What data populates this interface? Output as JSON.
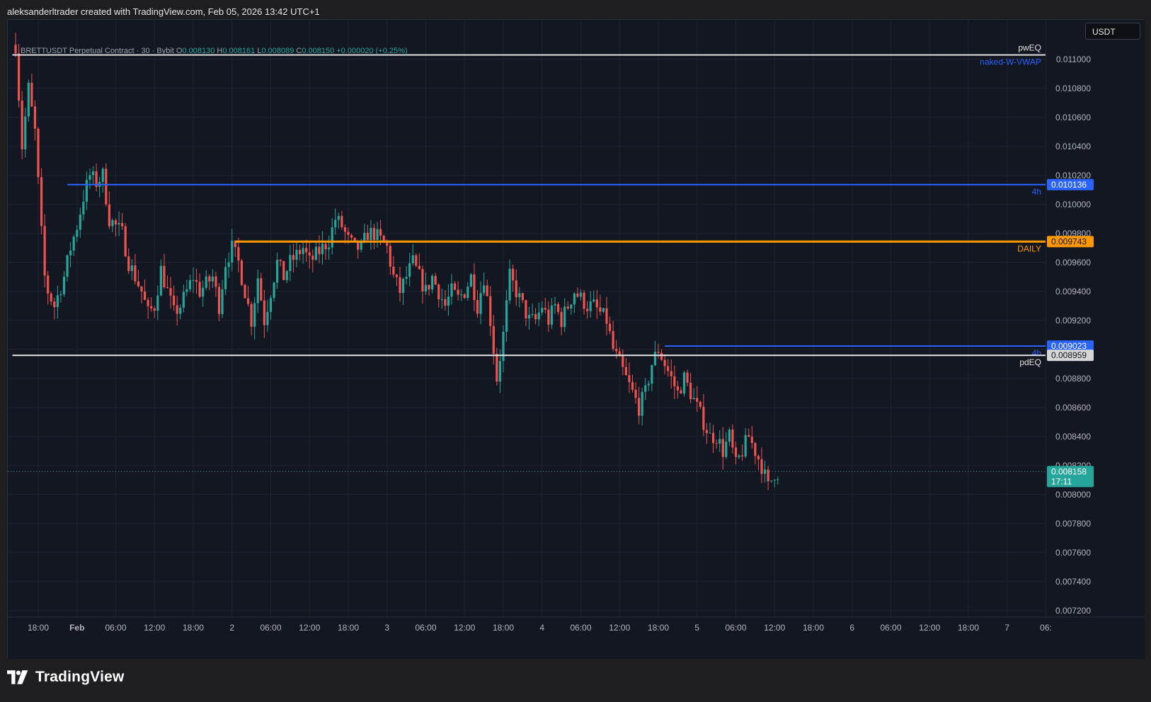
{
  "header": {
    "attribution": "aleksanderltrader created with TradingView.com, Feb 05, 2026 13:42 UTC+1"
  },
  "legend": {
    "symbol": "BRETTUSDT Perpetual Contract · 30 · Bybit",
    "open_label": "O",
    "open": "0.008130",
    "high_label": "H",
    "high": "0.008161",
    "low_label": "L",
    "low": "0.008089",
    "close_label": "C",
    "close": "0.008150",
    "change": "+0.000020 (+0.25%)"
  },
  "currency": "USDT",
  "brand": {
    "name": "TradingView"
  },
  "colors": {
    "up": "#26a69a",
    "down": "#ef5350",
    "blue_level": "#2962ff",
    "orange_level": "#ff9800",
    "white_level": "#e0e0e0",
    "background": "#131722",
    "grid": "#1f2330"
  },
  "chart_data": {
    "type": "candlestick",
    "symbol": "BRETTUSDT Perpetual Contract",
    "interval": "30",
    "exchange": "Bybit",
    "ylim": [
      0.0071,
      0.01115
    ],
    "y_ticks": [
      0.0072,
      0.0074,
      0.0076,
      0.0078,
      0.008,
      0.0082,
      0.0084,
      0.0086,
      0.0088,
      0.009,
      0.0092,
      0.0094,
      0.0096,
      0.0098,
      0.01,
      0.0102,
      0.0104,
      0.0106,
      0.0108,
      0.011
    ],
    "x_labels": [
      {
        "h": -6,
        "label": "18:00"
      },
      {
        "h": 0,
        "label": "Feb"
      },
      {
        "h": 6,
        "label": "06:00"
      },
      {
        "h": 12,
        "label": "12:00"
      },
      {
        "h": 18,
        "label": "18:00"
      },
      {
        "h": 24,
        "label": "2"
      },
      {
        "h": 30,
        "label": "06:00"
      },
      {
        "h": 36,
        "label": "12:00"
      },
      {
        "h": 42,
        "label": "18:00"
      },
      {
        "h": 48,
        "label": "3"
      },
      {
        "h": 54,
        "label": "06:00"
      },
      {
        "h": 60,
        "label": "12:00"
      },
      {
        "h": 66,
        "label": "18:00"
      },
      {
        "h": 72,
        "label": "4"
      },
      {
        "h": 78,
        "label": "06:00"
      },
      {
        "h": 84,
        "label": "12:00"
      },
      {
        "h": 90,
        "label": "18:00"
      },
      {
        "h": 96,
        "label": "5"
      },
      {
        "h": 102,
        "label": "06:00"
      },
      {
        "h": 108,
        "label": "12:00"
      },
      {
        "h": 114,
        "label": "18:00"
      },
      {
        "h": 120,
        "label": "6"
      },
      {
        "h": 126,
        "label": "06:00"
      },
      {
        "h": 132,
        "label": "12:00"
      },
      {
        "h": 138,
        "label": "18:00"
      },
      {
        "h": 144,
        "label": "7"
      },
      {
        "h": 150,
        "label": "06:"
      }
    ],
    "price_path": [
      [
        -9.5,
        0.0111
      ],
      [
        -8.5,
        0.0104
      ],
      [
        -7.5,
        0.0108
      ],
      [
        -6.5,
        0.0105
      ],
      [
        -5.5,
        0.0098
      ],
      [
        -5,
        0.0095
      ],
      [
        -4.5,
        0.0094
      ],
      [
        -3.5,
        0.0093
      ],
      [
        -2,
        0.0095
      ],
      [
        -1,
        0.0097
      ],
      [
        0,
        0.00985
      ],
      [
        0.5,
        0.00995
      ],
      [
        1,
        0.01005
      ],
      [
        2,
        0.0102
      ],
      [
        3,
        0.01015
      ],
      [
        4,
        0.0102
      ],
      [
        5,
        0.0099
      ],
      [
        6,
        0.00985
      ],
      [
        7,
        0.0098
      ],
      [
        8,
        0.0096
      ],
      [
        9,
        0.0095
      ],
      [
        10,
        0.0094
      ],
      [
        11,
        0.00925
      ],
      [
        12,
        0.0093
      ],
      [
        13,
        0.00955
      ],
      [
        14,
        0.0094
      ],
      [
        15,
        0.00925
      ],
      [
        16,
        0.0093
      ],
      [
        17,
        0.0094
      ],
      [
        18,
        0.0095
      ],
      [
        19,
        0.0094
      ],
      [
        20,
        0.00945
      ],
      [
        21,
        0.0095
      ],
      [
        22,
        0.0093
      ],
      [
        23,
        0.0096
      ],
      [
        24,
        0.0097
      ],
      [
        25,
        0.0096
      ],
      [
        26,
        0.0094
      ],
      [
        27,
        0.0092
      ],
      [
        28,
        0.0095
      ],
      [
        29,
        0.0092
      ],
      [
        30,
        0.0094
      ],
      [
        31,
        0.0096
      ],
      [
        32,
        0.0095
      ],
      [
        33,
        0.0096
      ],
      [
        34,
        0.00965
      ],
      [
        35,
        0.0097
      ],
      [
        36,
        0.0096
      ],
      [
        37,
        0.00965
      ],
      [
        38,
        0.0097
      ],
      [
        39,
        0.00975
      ],
      [
        40,
        0.0099
      ],
      [
        41,
        0.00985
      ],
      [
        42,
        0.00975
      ],
      [
        43,
        0.0097
      ],
      [
        44,
        0.0097
      ],
      [
        45,
        0.0098
      ],
      [
        46,
        0.0098
      ],
      [
        47,
        0.00975
      ],
      [
        48,
        0.0097
      ],
      [
        49,
        0.0095
      ],
      [
        50,
        0.0094
      ],
      [
        51,
        0.0095
      ],
      [
        52,
        0.0096
      ],
      [
        53,
        0.0095
      ],
      [
        54,
        0.0094
      ],
      [
        55,
        0.0095
      ],
      [
        56,
        0.0094
      ],
      [
        57,
        0.0093
      ],
      [
        58,
        0.0094
      ],
      [
        59,
        0.00935
      ],
      [
        60,
        0.0094
      ],
      [
        61,
        0.0095
      ],
      [
        62,
        0.0093
      ],
      [
        63,
        0.0095
      ],
      [
        64,
        0.0092
      ],
      [
        65,
        0.0088
      ],
      [
        66,
        0.0091
      ],
      [
        67,
        0.0095
      ],
      [
        68,
        0.0094
      ],
      [
        69,
        0.0093
      ],
      [
        70,
        0.0092
      ],
      [
        71,
        0.0092
      ],
      [
        72,
        0.0093
      ],
      [
        73,
        0.0092
      ],
      [
        74,
        0.0093
      ],
      [
        75,
        0.0092
      ],
      [
        76,
        0.0093
      ],
      [
        77,
        0.0094
      ],
      [
        78,
        0.00935
      ],
      [
        79,
        0.0093
      ],
      [
        80,
        0.0093
      ],
      [
        81,
        0.00925
      ],
      [
        82,
        0.0092
      ],
      [
        83,
        0.009
      ],
      [
        84,
        0.0089
      ],
      [
        85,
        0.0088
      ],
      [
        86,
        0.0087
      ],
      [
        87,
        0.0086
      ],
      [
        88,
        0.0087
      ],
      [
        89,
        0.0089
      ],
      [
        90,
        0.009
      ],
      [
        91,
        0.0089
      ],
      [
        92,
        0.0088
      ],
      [
        93,
        0.0087
      ],
      [
        94,
        0.0088
      ],
      [
        95,
        0.0087
      ],
      [
        96,
        0.0086
      ],
      [
        97,
        0.0085
      ],
      [
        98,
        0.0084
      ],
      [
        99,
        0.0084
      ],
      [
        100,
        0.0083
      ],
      [
        101,
        0.0084
      ],
      [
        102,
        0.0082
      ],
      [
        103,
        0.0083
      ],
      [
        104,
        0.0084
      ],
      [
        105,
        0.0083
      ],
      [
        106,
        0.0082
      ],
      [
        107,
        0.00805
      ],
      [
        108,
        0.00815
      ]
    ],
    "last_candle_h": 108.5,
    "levels": [
      {
        "name": "pwEQ",
        "price": 0.01103,
        "color": "#e0e0e0",
        "width": 2,
        "start_h": -10,
        "label": "pwEQ",
        "label_pos": "above"
      },
      {
        "name": "naked-W-VWAP",
        "price": 0.01103,
        "color": "#2962ff",
        "width": 0,
        "start_h": -10,
        "label": "naked-W-VWAP",
        "label_pos": "below"
      },
      {
        "name": "4h",
        "price": 0.010136,
        "color": "#2962ff",
        "width": 2,
        "start_h": -1.5,
        "label": "4h",
        "label_pos": "below",
        "tag": "0.010136"
      },
      {
        "name": "DAILY",
        "price": 0.009743,
        "color": "#ff9800",
        "width": 3,
        "start_h": 24.5,
        "label": "DAILY",
        "label_pos": "below",
        "tag": "0.009743"
      },
      {
        "name": "4h-2",
        "price": 0.009023,
        "color": "#2962ff",
        "width": 2,
        "start_h": 91,
        "label": "4h",
        "label_pos": "below",
        "tag": "0.009023"
      },
      {
        "name": "pdEQ",
        "price": 0.008959,
        "color": "#e0e0e0",
        "width": 2,
        "start_h": -10,
        "label": "pdEQ",
        "label_pos": "below",
        "tag": "0.008959"
      }
    ],
    "last_price": 0.008158,
    "last_price_tag": "0.008158",
    "countdown": "17:11"
  }
}
